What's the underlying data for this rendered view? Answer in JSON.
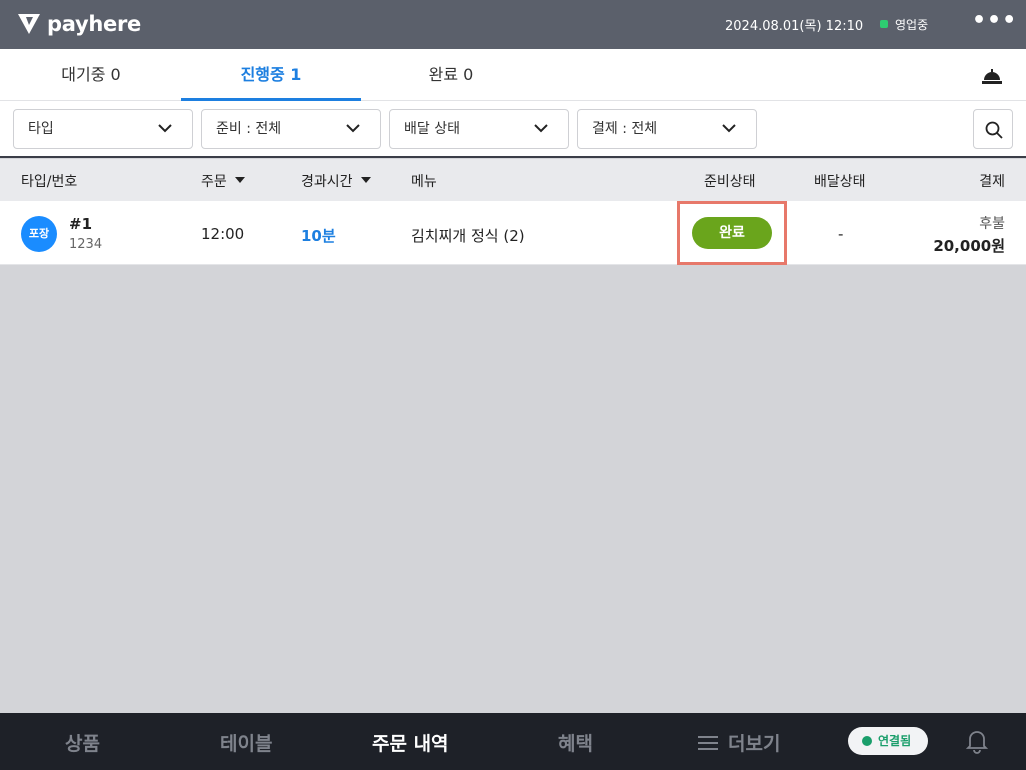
{
  "app": {
    "brand": "payhere",
    "datetime": "2024.08.01(목) 12:10",
    "status": "영업중",
    "more": "•••"
  },
  "tabs": [
    {
      "label": "대기중 0"
    },
    {
      "label": "진행중 1"
    },
    {
      "label": "완료 0"
    }
  ],
  "filters": [
    {
      "label": "타입"
    },
    {
      "label": "준비 : 전체"
    },
    {
      "label": "배달 상태"
    },
    {
      "label": "결제 : 전체"
    }
  ],
  "table": {
    "headers": {
      "type": "타입/번호",
      "order": "주문",
      "elapsed": "경과시간",
      "menu": "메뉴",
      "prep": "준비상태",
      "delivery": "배달상태",
      "payment": "결제"
    },
    "rows": [
      {
        "badge": "포장",
        "number": "#1",
        "sub": "1234",
        "time": "12:00",
        "elapsed": "10분",
        "menu": "김치찌개 정식 (2)",
        "prep_button": "완료",
        "delivery": "-",
        "pay_type": "후불",
        "amount": "20,000원"
      }
    ]
  },
  "bottom_nav": {
    "products": "상품",
    "tables": "테이블",
    "orders": "주문 내역",
    "benefits": "혜택",
    "more": "더보기",
    "connection": "연결됨"
  },
  "colors": {
    "accent": "#1d7fe0",
    "done": "#6aa51c",
    "highlight": "#e7786a",
    "connected": "#1a9e6b"
  }
}
